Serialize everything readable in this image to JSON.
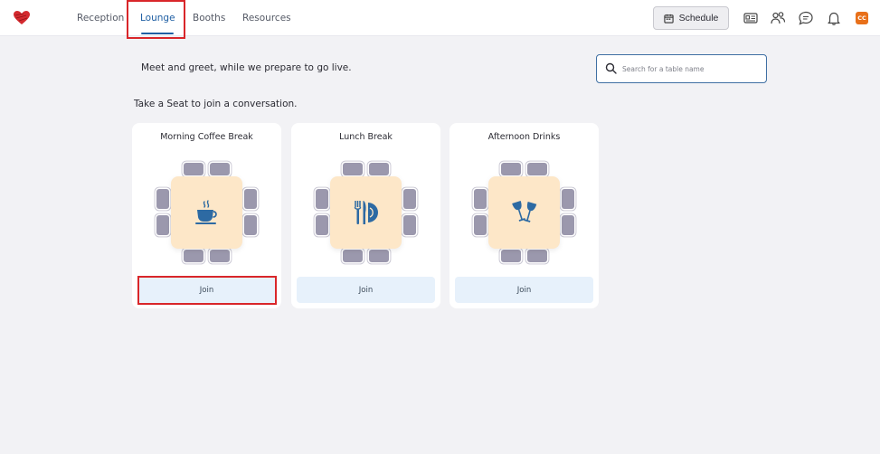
{
  "nav": {
    "items": [
      {
        "label": "Reception"
      },
      {
        "label": "Lounge",
        "active": true
      },
      {
        "label": "Booths"
      },
      {
        "label": "Resources"
      }
    ],
    "schedule_label": "Schedule",
    "avatar_initials": "CC"
  },
  "lounge": {
    "intro": "Meet and greet, while we prepare to go live.",
    "search_placeholder": "Search for a table name",
    "subtitle": "Take a Seat to join a conversation."
  },
  "tables": [
    {
      "name": "Morning Coffee Break",
      "icon": "coffee-cup-icon",
      "join_label": "Join"
    },
    {
      "name": "Lunch Break",
      "icon": "fork-knife-plate-icon",
      "join_label": "Join"
    },
    {
      "name": "Afternoon Drinks",
      "icon": "wine-glasses-icon",
      "join_label": "Join"
    }
  ],
  "colors": {
    "accent": "#1f5fa3",
    "highlight": "#d9262a",
    "avatar": "#e8701a",
    "table_top": "#fde7c8",
    "seat": "#9b98ad",
    "join_button": "#e7f1fb"
  }
}
